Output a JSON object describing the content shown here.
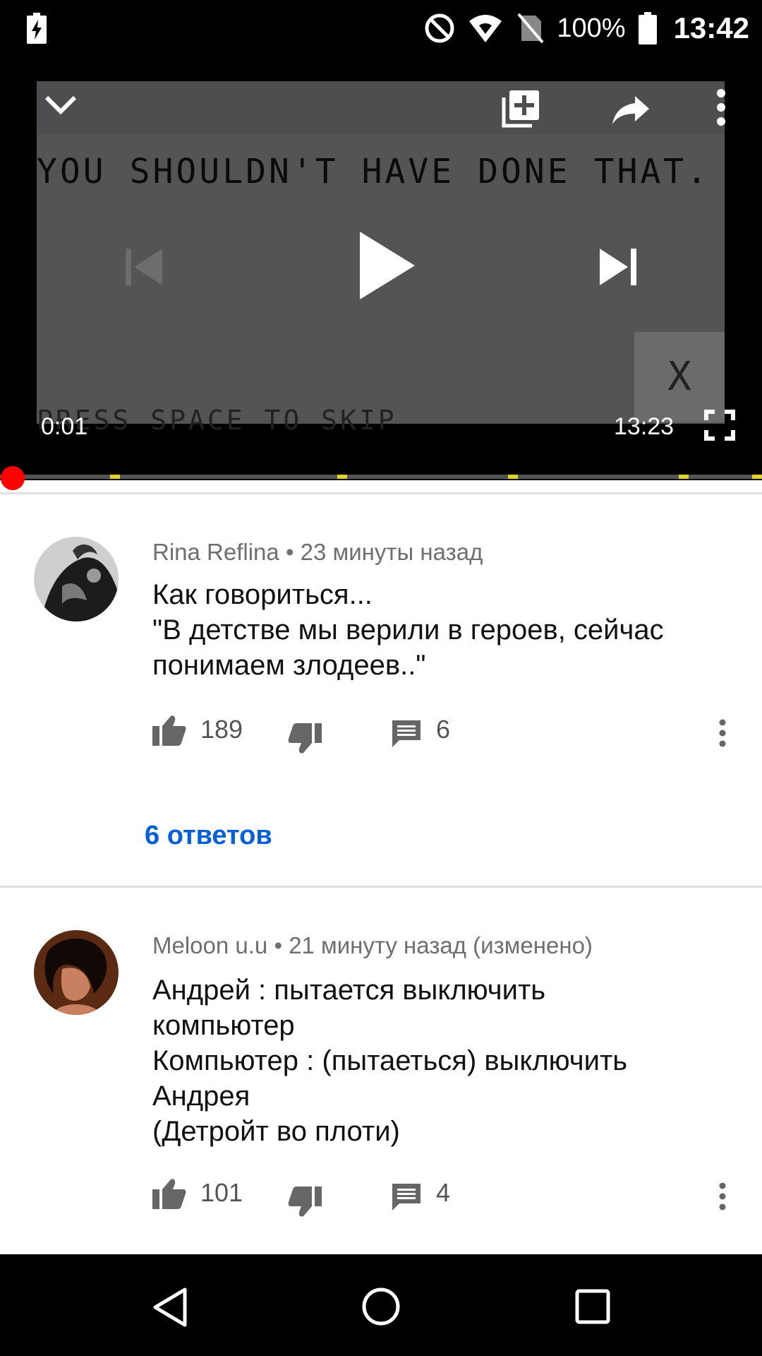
{
  "status_bar": {
    "battery_percent": "100%",
    "time": "13:42"
  },
  "player": {
    "game_title": "YOU SHOULDN'T HAVE DONE THAT.",
    "game_skip_hint": "PRESS SPACE TO SKIP",
    "game_close_glyph": "X",
    "current_time": "0:01",
    "duration": "13:23",
    "progress_fraction": 0.001
  },
  "comments": [
    {
      "author": "Rina Reflina",
      "time": "23 минуты назад",
      "lines": [
        "Как говориться...",
        "\"В детстве мы верили в героев, сейчас",
        "понимаем злодеев..\""
      ],
      "likes": "189",
      "replies_count": "6",
      "replies_link": "6 ответов"
    },
    {
      "author": "Meloon u.u",
      "time": "21 минуту назад (изменено)",
      "lines": [
        "Андрей : пытается выключить",
        "компьютер",
        "Компьютер : (пытаеться) выключить",
        "Андрея",
        "(Детройт во плоти)"
      ],
      "likes": "101",
      "replies_count": "4"
    }
  ],
  "colors": {
    "accent_link": "#065fd4",
    "progress": "#ff0000",
    "chapter_marker": "#e1d230"
  }
}
